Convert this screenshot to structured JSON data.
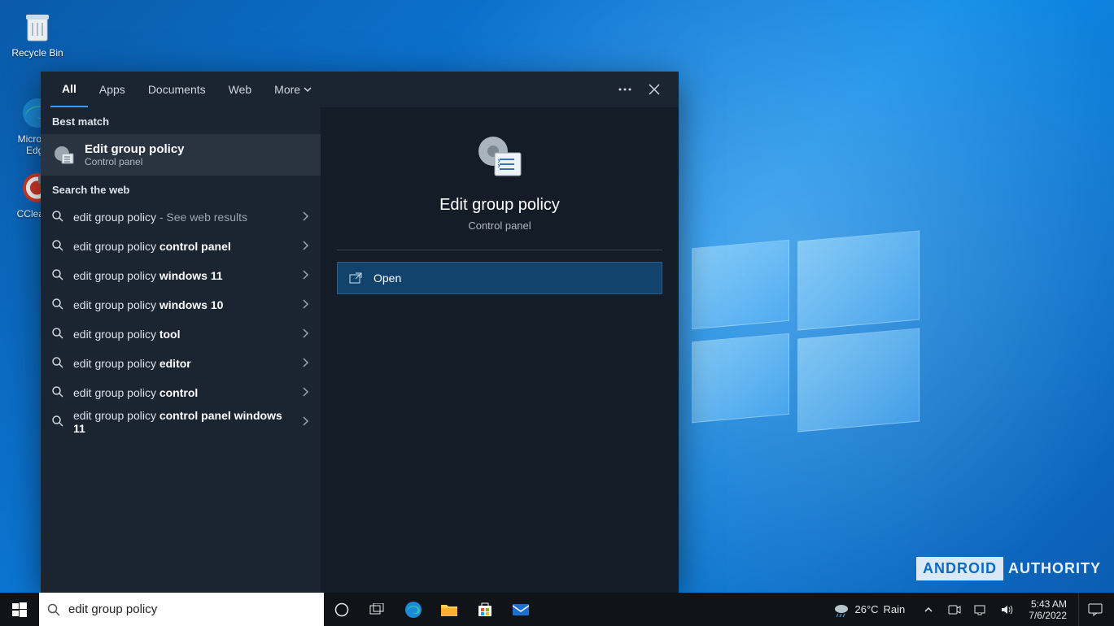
{
  "desktop": {
    "icons": [
      {
        "label": "Recycle Bin"
      },
      {
        "label": "Microsoft Edge"
      },
      {
        "label": "CCleaner"
      }
    ]
  },
  "panel": {
    "tabs": [
      "All",
      "Apps",
      "Documents",
      "Web",
      "More"
    ],
    "best_match_header": "Best match",
    "best_match": {
      "title": "Edit group policy",
      "subtitle": "Control panel"
    },
    "web_header": "Search the web",
    "web_results": [
      {
        "prefix": "edit group policy",
        "bold": "",
        "suffix": " - See web results"
      },
      {
        "prefix": "edit group policy ",
        "bold": "control panel",
        "suffix": ""
      },
      {
        "prefix": "edit group policy ",
        "bold": "windows 11",
        "suffix": ""
      },
      {
        "prefix": "edit group policy ",
        "bold": "windows 10",
        "suffix": ""
      },
      {
        "prefix": "edit group policy ",
        "bold": "tool",
        "suffix": ""
      },
      {
        "prefix": "edit group policy ",
        "bold": "editor",
        "suffix": ""
      },
      {
        "prefix": "edit group policy ",
        "bold": "control",
        "suffix": ""
      },
      {
        "prefix": "edit group policy ",
        "bold": "control panel windows 11",
        "suffix": ""
      }
    ],
    "detail": {
      "title": "Edit group policy",
      "subtitle": "Control panel",
      "open_label": "Open"
    }
  },
  "taskbar": {
    "search_value": "edit group policy",
    "weather": {
      "temp": "26°C",
      "cond": "Rain"
    },
    "clock": {
      "time": "5:43 AM",
      "date": "7/6/2022"
    }
  },
  "watermark": {
    "box": "ANDROID",
    "plain": "AUTHORITY"
  }
}
